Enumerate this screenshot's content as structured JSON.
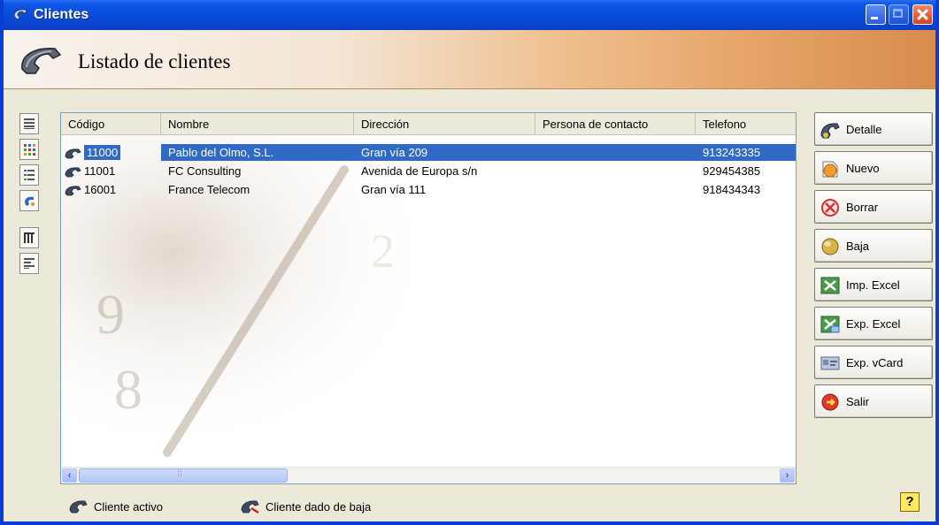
{
  "window": {
    "title": "Clientes"
  },
  "header": {
    "title": "Listado de clientes"
  },
  "left_toolbar": {
    "items": [
      "list-view-icon",
      "large-icons-view-icon",
      "details-view-icon",
      "contact-icon",
      "columns-icon",
      "report-icon"
    ]
  },
  "table": {
    "columns": [
      "Código",
      "Nombre",
      "Dirección",
      "Persona de contacto",
      "Telefono"
    ],
    "rows": [
      {
        "codigo": "11000",
        "nombre": "Pablo del Olmo, S.L.",
        "direccion": "Gran vía 209",
        "contacto": "",
        "telefono": "913243335",
        "selected": true,
        "status": "active"
      },
      {
        "codigo": "11001",
        "nombre": "FC Consulting",
        "direccion": "Avenida de Europa s/n",
        "contacto": "",
        "telefono": "929454385",
        "selected": false,
        "status": "active"
      },
      {
        "codigo": "16001",
        "nombre": "France Telecom",
        "direccion": "Gran vía 111",
        "contacto": "",
        "telefono": "918434343",
        "selected": false,
        "status": "active"
      }
    ]
  },
  "buttons": {
    "detalle": "Detalle",
    "nuevo": "Nuevo",
    "borrar": "Borrar",
    "baja": "Baja",
    "imp_excel": "Imp. Excel",
    "exp_excel": "Exp. Excel",
    "exp_vcard": "Exp. vCard",
    "salir": "Salir"
  },
  "legend": {
    "active": "Cliente activo",
    "inactive": "Cliente dado de baja"
  },
  "help": {
    "label": "?"
  },
  "colors": {
    "titlebar": "#0a4ad8",
    "selection": "#316ac5",
    "banner_accent": "#e6a468"
  }
}
